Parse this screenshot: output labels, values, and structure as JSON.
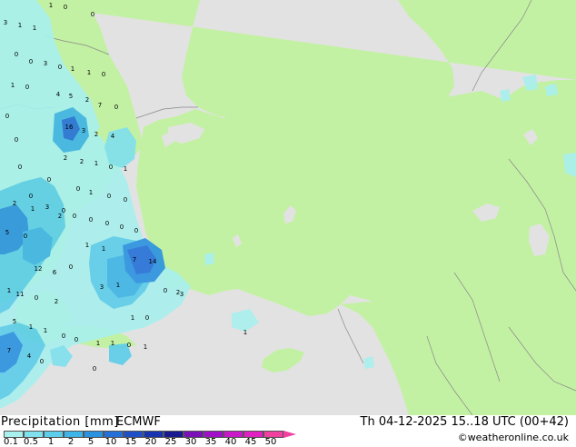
{
  "legend": {
    "title": "Precipitation [mm]",
    "model": "ECMWF",
    "valid_time": "Th 04-12-2025 15..18 UTC (00+42)",
    "credit": "©weatheronline.co.uk",
    "scale_labels": [
      "0.1",
      "0.5",
      "1",
      "2",
      "5",
      "10",
      "15",
      "20",
      "25",
      "30",
      "35",
      "40",
      "45",
      "50"
    ],
    "scale_colors": [
      "#a8f0ee",
      "#7fe0ee",
      "#5ccdea",
      "#3fb4e6",
      "#2b92e0",
      "#2470d8",
      "#1f50c8",
      "#1733b0",
      "#1a1a90",
      "#7a10b8",
      "#a010c8",
      "#c818c8",
      "#e020c0",
      "#f040a0"
    ]
  },
  "colors": {
    "sea": "#e2e2e2",
    "land": "#c3f1a3",
    "border": "#888888"
  },
  "map_values": [
    "3",
    "1",
    "1",
    "1",
    "0",
    "0",
    "0",
    "0",
    "3",
    "0",
    "1",
    "1",
    "0",
    "1",
    "0",
    "4",
    "5",
    "2",
    "7",
    "0",
    "0",
    "0",
    "16",
    "3",
    "2",
    "4",
    "0",
    "0",
    "2",
    "2",
    "1",
    "0",
    "1",
    "0",
    "3",
    "0",
    "0",
    "1",
    "0",
    "0",
    "2",
    "1",
    "2",
    "0",
    "0",
    "0",
    "0",
    "0",
    "5",
    "0",
    "12",
    "6",
    "0",
    "1",
    "1",
    "1",
    "11",
    "7",
    "14",
    "0",
    "2",
    "0",
    "2",
    "3",
    "1",
    "5",
    "1",
    "1",
    "0",
    "1",
    "0",
    "7",
    "4",
    "0",
    "0",
    "1",
    "1",
    "0",
    "1",
    "0",
    "1",
    "3"
  ]
}
